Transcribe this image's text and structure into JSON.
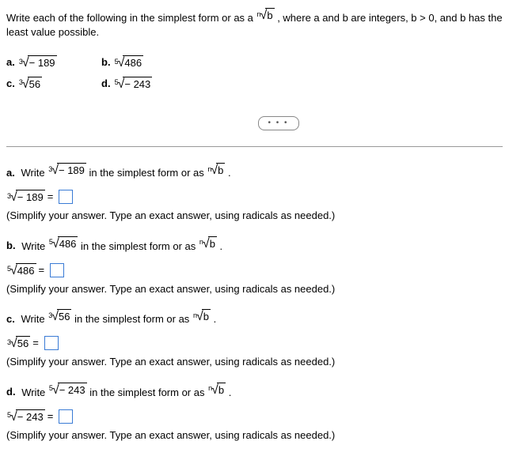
{
  "instruction": {
    "pre": "Write each of the following in the simplest form or as a",
    "root_index": "n",
    "root_radicand": "b",
    "post": ", where a and b are integers, b > 0, and b has the least value possible."
  },
  "problems": {
    "a": {
      "letter": "a.",
      "index": "3",
      "radicand": "− 189"
    },
    "b": {
      "letter": "b.",
      "index": "5",
      "radicand": "486"
    },
    "c": {
      "letter": "c.",
      "index": "3",
      "radicand": "56"
    },
    "d": {
      "letter": "d.",
      "index": "5",
      "radicand": "− 243"
    }
  },
  "overflow": "• • •",
  "parts": {
    "a": {
      "letter": "a.",
      "word": "Write",
      "index": "3",
      "radicand": "− 189",
      "mid": "in the simplest form or as",
      "n_index": "n",
      "n_radicand": "b",
      "period": ".",
      "eq_index": "3",
      "eq_radicand": "− 189",
      "equals": "=",
      "note": "(Simplify your answer. Type an exact answer, using radicals as needed.)"
    },
    "b": {
      "letter": "b.",
      "word": "Write",
      "index": "5",
      "radicand": "486",
      "mid": "in the simplest form or as",
      "n_index": "n",
      "n_radicand": "b",
      "period": ".",
      "eq_index": "5",
      "eq_radicand": "486",
      "equals": "=",
      "note": "(Simplify your answer. Type an exact answer, using radicals as needed.)"
    },
    "c": {
      "letter": "c.",
      "word": "Write",
      "index": "3",
      "radicand": "56",
      "mid": "in the simplest form or as",
      "n_index": "n",
      "n_radicand": "b",
      "period": ".",
      "eq_index": "3",
      "eq_radicand": "56",
      "equals": "=",
      "note": "(Simplify your answer. Type an exact answer, using radicals as needed.)"
    },
    "d": {
      "letter": "d.",
      "word": "Write",
      "index": "5",
      "radicand": "− 243",
      "mid": "in the simplest form or as",
      "n_index": "n",
      "n_radicand": "b",
      "period": ".",
      "eq_index": "5",
      "eq_radicand": "− 243",
      "equals": "=",
      "note": "(Simplify your answer. Type an exact answer, using radicals as needed.)"
    }
  }
}
